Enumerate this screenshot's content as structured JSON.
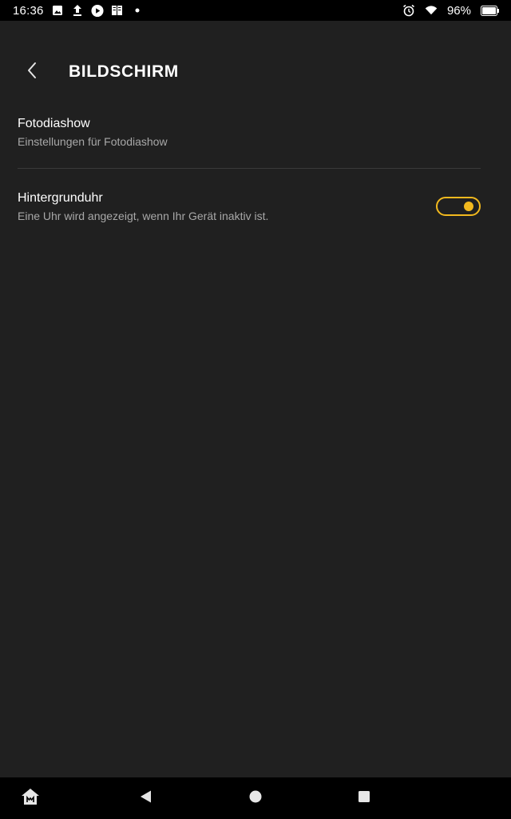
{
  "status_bar": {
    "time": "16:36",
    "battery_percent": "96%",
    "battery_level": 0.96,
    "left_icons": [
      "image-icon",
      "upload-icon",
      "play-icon",
      "book-icon",
      "dot-icon"
    ],
    "right_icons": [
      "alarm-icon",
      "wifi-icon",
      "battery-icon"
    ]
  },
  "header": {
    "title": "BILDSCHIRM",
    "back_icon": "chevron-left-icon"
  },
  "settings": [
    {
      "title": "Fotodiashow",
      "subtitle": "Einstellungen für Fotodiashow"
    },
    {
      "title": "Hintergrunduhr",
      "subtitle": "Eine Uhr wird angezeigt, wenn Ihr Gerät inaktiv ist.",
      "toggle_on": true
    }
  ],
  "navigation": {
    "buttons": [
      "home-app-icon",
      "back-triangle-icon",
      "home-circle-icon",
      "recents-square-icon"
    ]
  },
  "colors": {
    "background": "#202020",
    "status_bar": "#000000",
    "accent": "#f2b91e",
    "subtitle": "#a8a8a8",
    "divider": "#3a3a3a"
  }
}
